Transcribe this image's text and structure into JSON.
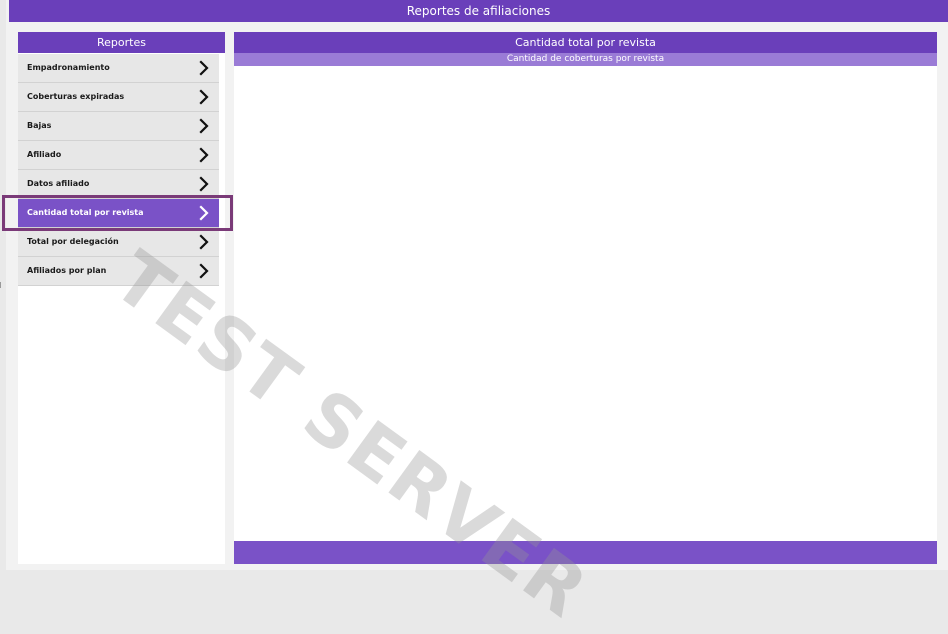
{
  "header": {
    "title": "Reportes de afiliaciones"
  },
  "sidebar": {
    "title": "Reportes",
    "items": [
      {
        "label": "Empadronamiento",
        "active": false
      },
      {
        "label": "Coberturas expiradas",
        "active": false
      },
      {
        "label": "Bajas",
        "active": false
      },
      {
        "label": "Afiliado",
        "active": false
      },
      {
        "label": "Datos afiliado",
        "active": false
      },
      {
        "label": "Cantidad total por revista",
        "active": true
      },
      {
        "label": "Total por delegación",
        "active": false
      },
      {
        "label": "Afiliados por plan",
        "active": false
      }
    ]
  },
  "main": {
    "title": "Cantidad total por revista",
    "subtitle": "Cantidad de coberturas por revista"
  },
  "watermark": {
    "text": "TEST SERVER"
  },
  "icons": {
    "menu_item": "chevron-right-icon"
  },
  "colors": {
    "primary": "#6a3fba",
    "active": "#7a52c7",
    "subheader": "#9a7bd6",
    "highlight": "#7a3a78"
  }
}
